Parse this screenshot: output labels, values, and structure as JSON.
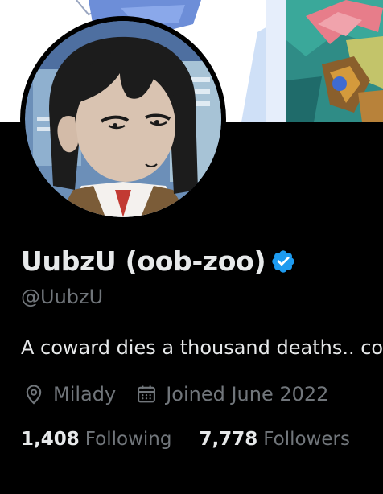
{
  "profile": {
    "display_name": "UubzU (oob-zoo)",
    "handle": "@UubzU",
    "bio": "A coward dies a thousand deaths.. co",
    "location": "Milady",
    "joined": "Joined June 2022",
    "verified_icon": "verified-badge-icon",
    "location_icon": "location-pin-icon",
    "calendar_icon": "calendar-icon"
  },
  "stats": {
    "following_count": "1,408",
    "following_label": "Following",
    "followers_count": "7,778",
    "followers_label": "Followers"
  },
  "colors": {
    "background": "#000000",
    "primary_text": "#e7e9ea",
    "secondary_text": "#71767b",
    "verified_blue": "#1d9bf0"
  }
}
